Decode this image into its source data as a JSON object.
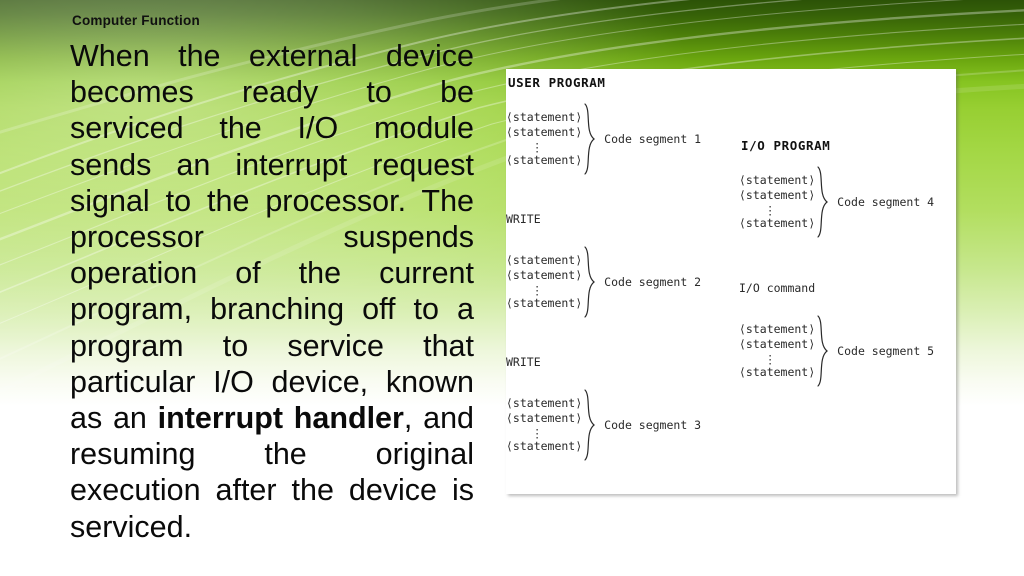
{
  "slide": {
    "title": "Computer Function",
    "body_parts": [
      {
        "text": "When the external device becomes ready to be serviced the I/O module sends an interrupt request signal to the processor. The processor suspends operation of the current program, branching off to a program to service that particular I/O device, known as an ",
        "bold": false
      },
      {
        "text": "interrupt handler",
        "bold": true
      },
      {
        "text": ", and resuming the original execution after the device is serviced.",
        "bold": false
      }
    ]
  },
  "theme": {
    "accent_dark_green": "#2c5207",
    "accent_green": "#97cf32",
    "accent_light_green": "#c6e78c",
    "panel_background": "#ffffff",
    "text_color": "#0a0a0a"
  },
  "diagram": {
    "statement_label": "⟨statement⟩",
    "dots": "⋮",
    "user_program": {
      "heading": "USER PROGRAM",
      "blocks": [
        {
          "kind": "segment",
          "caption": "Code segment 1"
        },
        {
          "kind": "plain",
          "text": "WRITE"
        },
        {
          "kind": "segment",
          "caption": "Code segment 2"
        },
        {
          "kind": "plain",
          "text": "WRITE"
        },
        {
          "kind": "segment",
          "caption": "Code segment 3"
        }
      ]
    },
    "io_program": {
      "heading": "I/O PROGRAM",
      "blocks": [
        {
          "kind": "segment",
          "caption": "Code segment 4"
        },
        {
          "kind": "plain",
          "text": "I/O command"
        },
        {
          "kind": "segment",
          "caption": "Code segment 5"
        }
      ]
    }
  }
}
